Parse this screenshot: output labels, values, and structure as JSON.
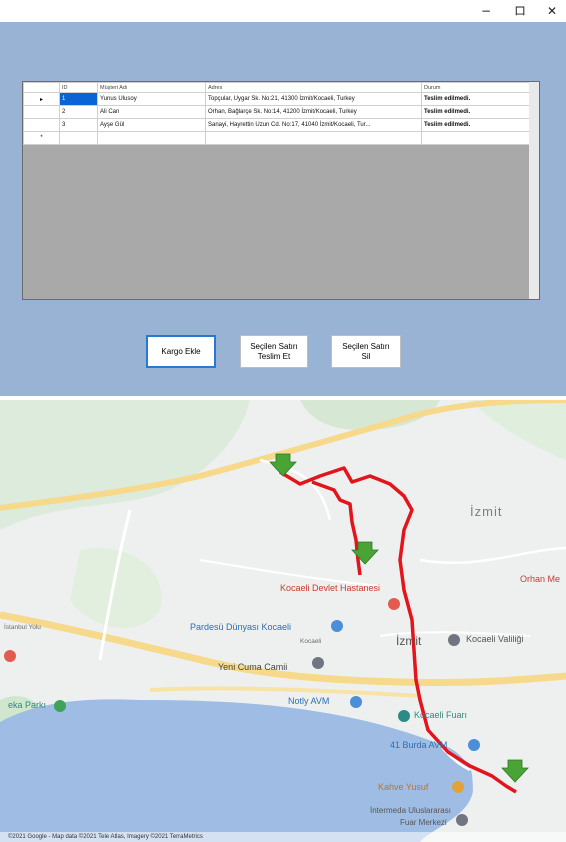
{
  "window": {
    "min": "−",
    "max": "ロ",
    "close": "✕"
  },
  "grid": {
    "columns": [
      "ID",
      "Müşteri Adı",
      "Adres",
      "Durum"
    ],
    "rows": [
      {
        "marker": "▸",
        "id": "1",
        "name": "Yunus Ulusoy",
        "address": "Topçular, Uygar Sk. No:21, 41300 İzmit/Kocaeli, Turkey",
        "status": "Teslim edilmedi."
      },
      {
        "marker": "",
        "id": "2",
        "name": "Ali Can",
        "address": "Orhan, Bağlarçe Sk. No:14, 41200 İzmit/Kocaeli, Turkey",
        "status": "Teslim edilmedi."
      },
      {
        "marker": "",
        "id": "3",
        "name": "Ayşe Gül",
        "address": "Sanayi, Hayrettin Uzun Cd. No:17, 41040 İzmit/Kocaeli, Tur...",
        "status": "Teslim edilmedi."
      }
    ],
    "new_row_marker": "*"
  },
  "buttons": {
    "add": "Kargo Ekle",
    "deliver": "Seçilen Satırı\nTeslim Et",
    "delete": "Seçilen Satırı\nSil"
  },
  "map": {
    "labels": {
      "izmit_big": "İzmit",
      "kocaeli_devlet": "Kocaeli Devlet Hastanesi",
      "pardesu": "Pardesü Dünyası Kocaeli",
      "yeni_cuma": "Yeni Cuma Camii",
      "izmit_center": "İzmit",
      "kocaeli_valiligi": "Kocaeli Valiliği",
      "notly": "Notly AVM",
      "kocaeli_fuari": "Kocaeli Fuarı",
      "burda_avm": "41 Burda AVM",
      "kahve_yusuf": "Kahve Yusuf",
      "istanbul_yolu": "İstanbul Yolu",
      "orhan_mah": "Orhan Me",
      "teksa": "eka Parkı",
      "intermed": "İntermeda Uluslararası",
      "intermed2": "Fuar Merkezi",
      "kocaeli_small": "Kocaeli"
    },
    "attribution": "©2021 Google - Map data ©2021 Tele Atlas, Imagery ©2021 TerraMetrics",
    "colors": {
      "route": "#e3141b",
      "sea": "#9fbde4",
      "land": "#eef0ef",
      "marker": "#4aa335"
    }
  }
}
